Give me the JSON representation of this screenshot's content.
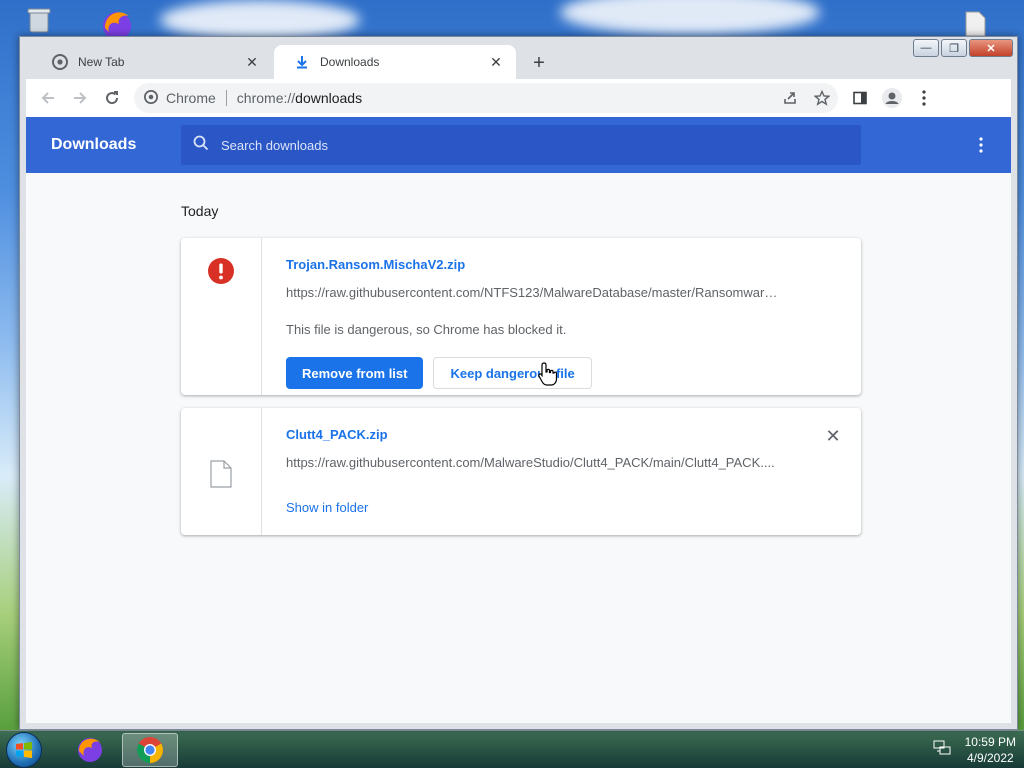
{
  "browser": {
    "tabs": [
      {
        "title": "New Tab",
        "icon": "chrome-icon"
      },
      {
        "title": "Downloads",
        "icon": "download-icon"
      }
    ],
    "omnibox": {
      "site_label": "Chrome",
      "url_scheme": "chrome://",
      "url_host": "downloads"
    }
  },
  "downloads_page": {
    "title": "Downloads",
    "search_placeholder": "Search downloads",
    "section_label": "Today",
    "items": [
      {
        "filename": "Trojan.Ransom.MischaV2.zip",
        "url": "https://raw.githubusercontent.com/NTFS123/MalwareDatabase/master/Ransomwar…",
        "status": "This file is dangerous, so Chrome has blocked it.",
        "primary_action": "Remove from list",
        "secondary_action": "Keep dangerous file",
        "icon": "danger-icon"
      },
      {
        "filename": "Clutt4_PACK.zip",
        "url": "https://raw.githubusercontent.com/MalwareStudio/Clutt4_PACK/main/Clutt4_PACK....",
        "link": "Show in folder",
        "icon": "file-icon"
      }
    ]
  },
  "taskbar": {
    "time": "10:59 PM",
    "date": "4/9/2022"
  },
  "colors": {
    "accent": "#1a73e8",
    "header": "#3367d6",
    "danger": "#d93025"
  }
}
